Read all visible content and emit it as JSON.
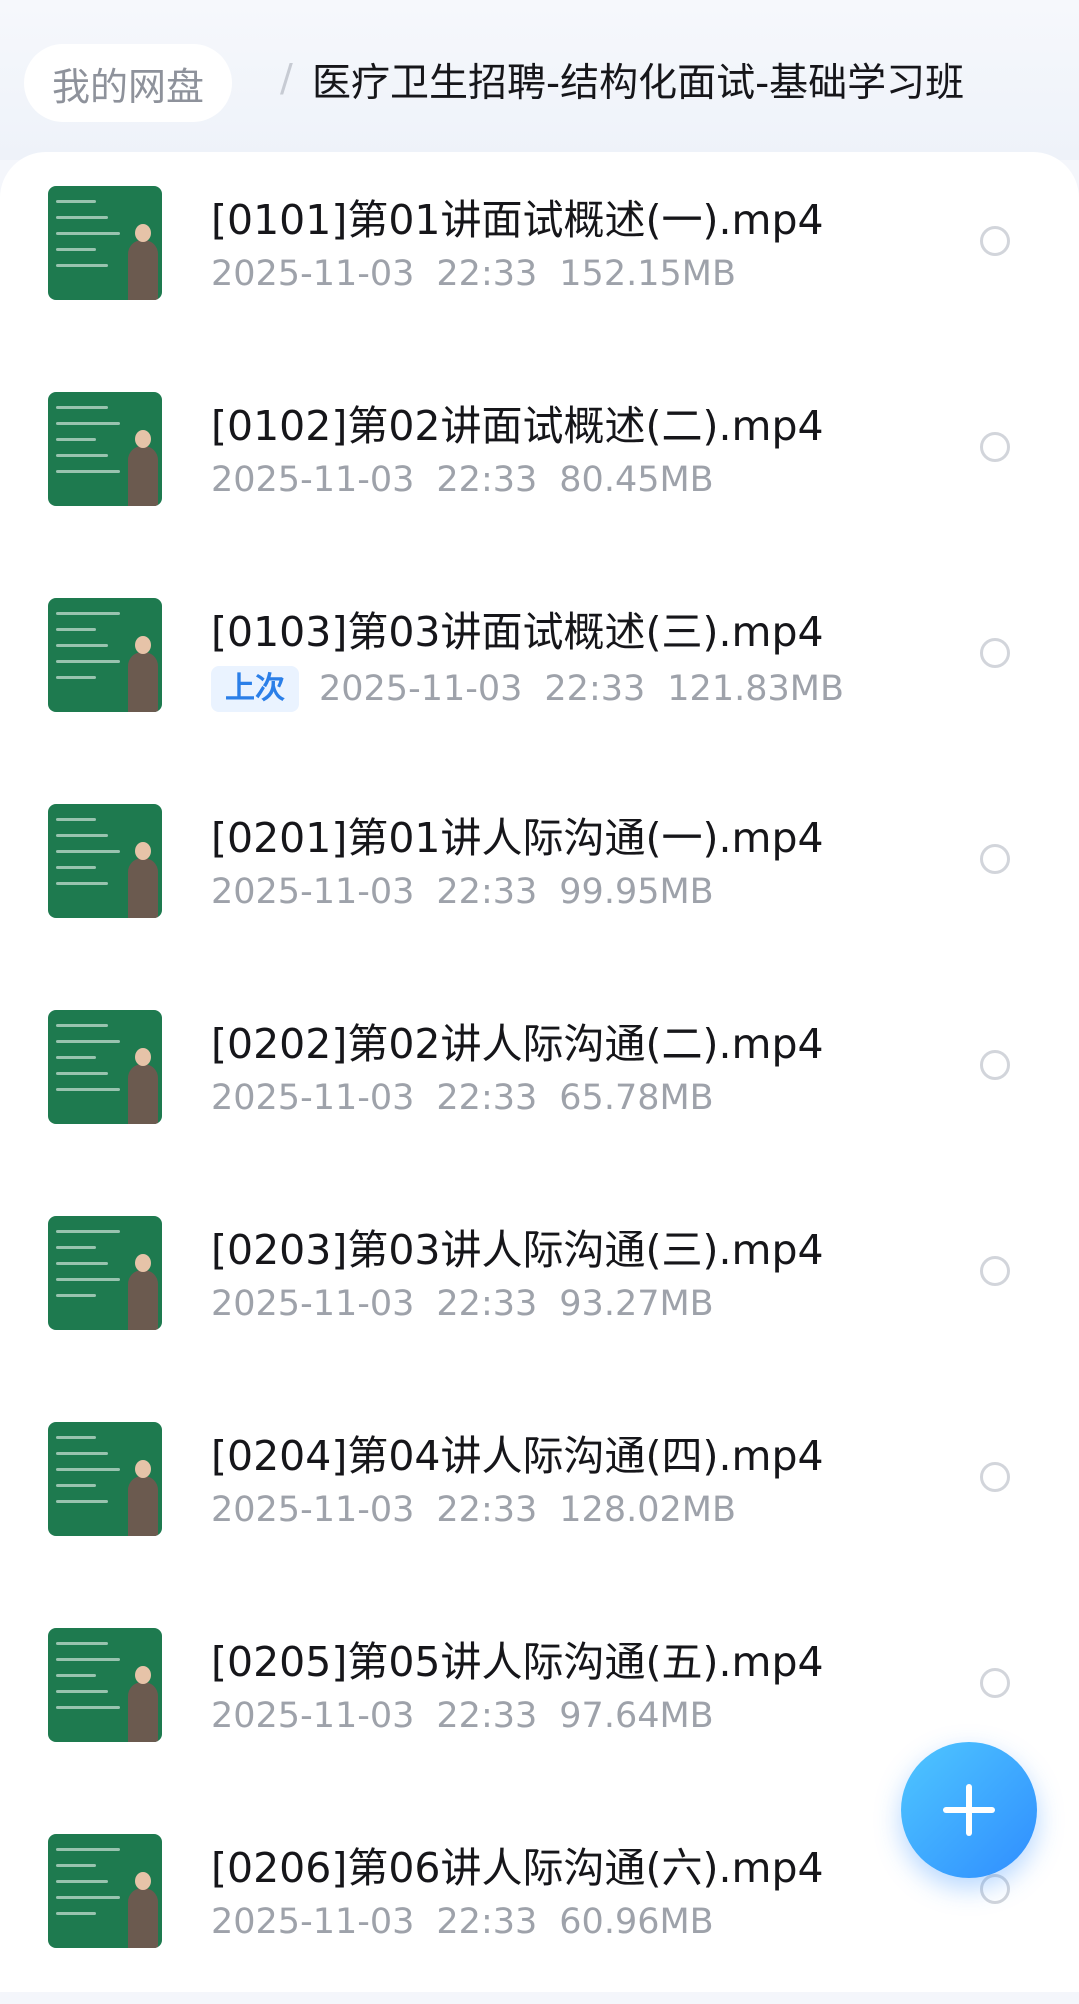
{
  "breadcrumb": {
    "root": "我的网盘",
    "separator": "/",
    "current": "医疗卫生招聘-结构化面试-基础学习班"
  },
  "files": [
    {
      "name": "[0101]第01讲面试概述(一).mp4",
      "badge": "",
      "date": "2025-11-03",
      "time": "22:33",
      "size": "152.15MB"
    },
    {
      "name": "[0102]第02讲面试概述(二).mp4",
      "badge": "",
      "date": "2025-11-03",
      "time": "22:33",
      "size": "80.45MB"
    },
    {
      "name": "[0103]第03讲面试概述(三).mp4",
      "badge": "上次",
      "date": "2025-11-03",
      "time": "22:33",
      "size": "121.83MB"
    },
    {
      "name": "[0201]第01讲人际沟通(一).mp4",
      "badge": "",
      "date": "2025-11-03",
      "time": "22:33",
      "size": "99.95MB"
    },
    {
      "name": "[0202]第02讲人际沟通(二).mp4",
      "badge": "",
      "date": "2025-11-03",
      "time": "22:33",
      "size": "65.78MB"
    },
    {
      "name": "[0203]第03讲人际沟通(三).mp4",
      "badge": "",
      "date": "2025-11-03",
      "time": "22:33",
      "size": "93.27MB"
    },
    {
      "name": "[0204]第04讲人际沟通(四).mp4",
      "badge": "",
      "date": "2025-11-03",
      "time": "22:33",
      "size": "128.02MB"
    },
    {
      "name": "[0205]第05讲人际沟通(五).mp4",
      "badge": "",
      "date": "2025-11-03",
      "time": "22:33",
      "size": "97.64MB"
    },
    {
      "name": "[0206]第06讲人际沟通(六).mp4",
      "badge": "",
      "date": "2025-11-03",
      "time": "22:33",
      "size": "60.96MB"
    }
  ],
  "fab": {
    "icon": "plus-icon"
  },
  "colors": {
    "accent": "#2f8dff",
    "badge_text": "#2b7fe8",
    "thumb_bg": "#1e7a4f"
  }
}
